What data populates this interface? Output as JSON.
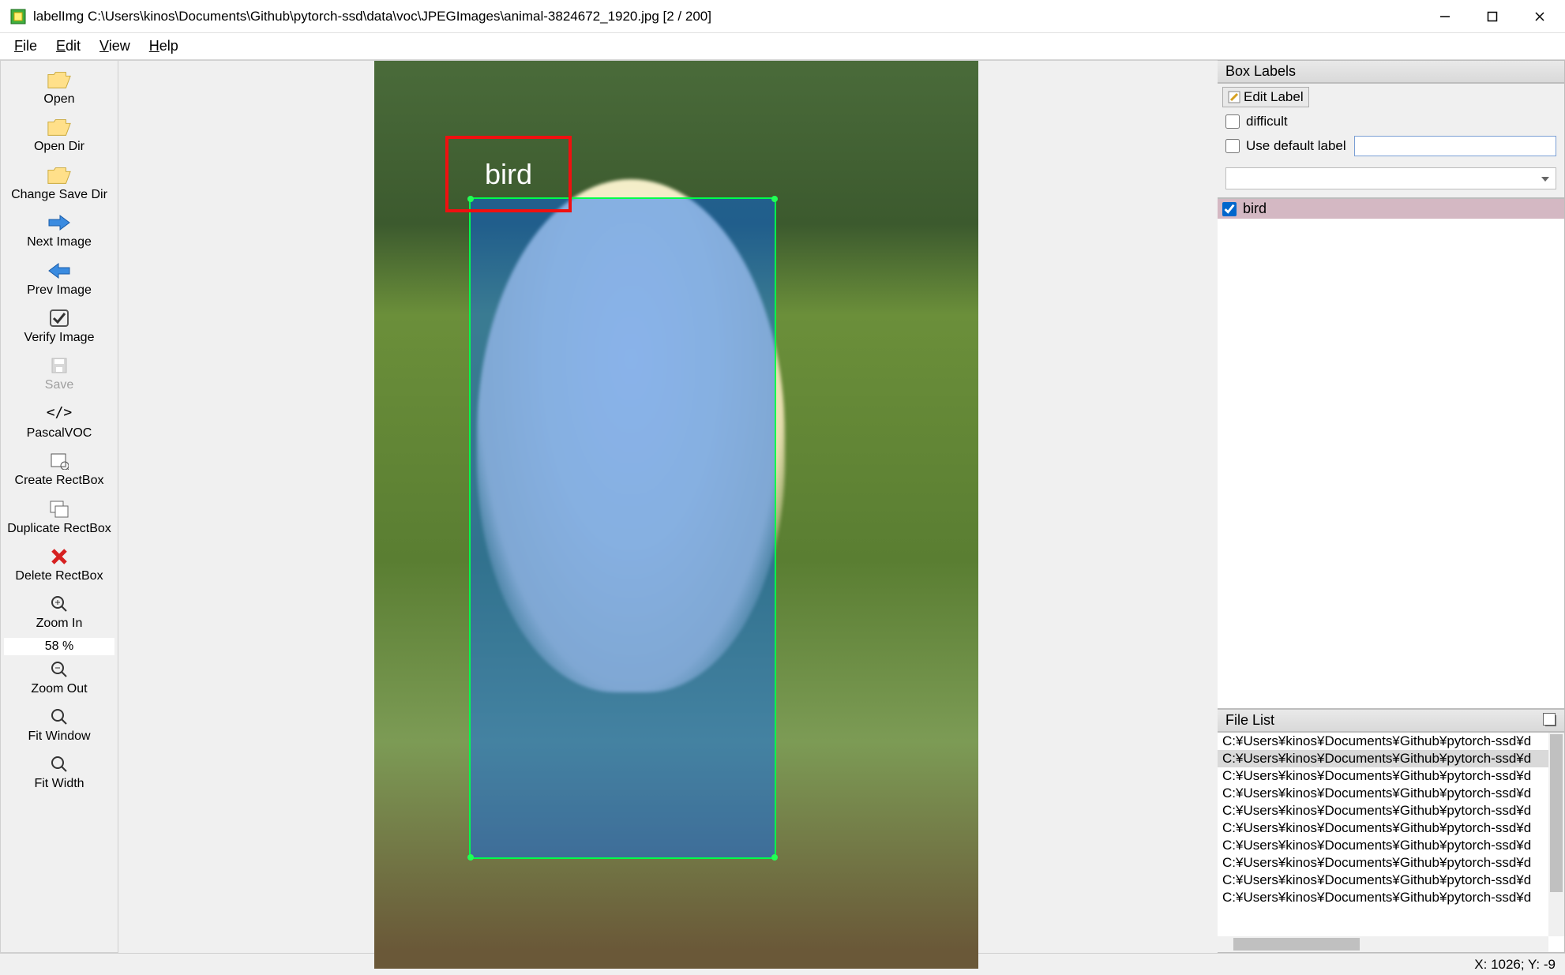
{
  "title": "labelImg C:\\Users\\kinos\\Documents\\Github\\pytorch-ssd\\data\\voc\\JPEGImages\\animal-3824672_1920.jpg [2 / 200]",
  "menu": {
    "file": "File",
    "edit": "Edit",
    "view": "View",
    "help": "Help"
  },
  "tools": {
    "open": "Open",
    "open_dir": "Open Dir",
    "change_save_dir": "Change Save Dir",
    "next_image": "Next Image",
    "prev_image": "Prev Image",
    "verify_image": "Verify Image",
    "save": "Save",
    "format": "PascalVOC",
    "create_rect": "Create RectBox",
    "duplicate_rect": "Duplicate RectBox",
    "delete_rect": "Delete RectBox",
    "zoom_in": "Zoom In",
    "zoom_val": "58 %",
    "zoom_out": "Zoom Out",
    "fit_window": "Fit Window",
    "fit_width": "Fit Width"
  },
  "annotation": {
    "label": "bird"
  },
  "box_panel": {
    "title": "Box Labels",
    "edit_label": "Edit Label",
    "difficult": "difficult",
    "use_default_label": "Use default label",
    "default_label_value": "",
    "labels": [
      {
        "name": "bird",
        "checked": true
      }
    ]
  },
  "file_list": {
    "title": "File List",
    "items": [
      "C:¥Users¥kinos¥Documents¥Github¥pytorch-ssd¥d",
      "C:¥Users¥kinos¥Documents¥Github¥pytorch-ssd¥d",
      "C:¥Users¥kinos¥Documents¥Github¥pytorch-ssd¥d",
      "C:¥Users¥kinos¥Documents¥Github¥pytorch-ssd¥d",
      "C:¥Users¥kinos¥Documents¥Github¥pytorch-ssd¥d",
      "C:¥Users¥kinos¥Documents¥Github¥pytorch-ssd¥d",
      "C:¥Users¥kinos¥Documents¥Github¥pytorch-ssd¥d",
      "C:¥Users¥kinos¥Documents¥Github¥pytorch-ssd¥d",
      "C:¥Users¥kinos¥Documents¥Github¥pytorch-ssd¥d",
      "C:¥Users¥kinos¥Documents¥Github¥pytorch-ssd¥d"
    ],
    "selected_index": 1
  },
  "status": {
    "coords": "X: 1026; Y: -9"
  }
}
